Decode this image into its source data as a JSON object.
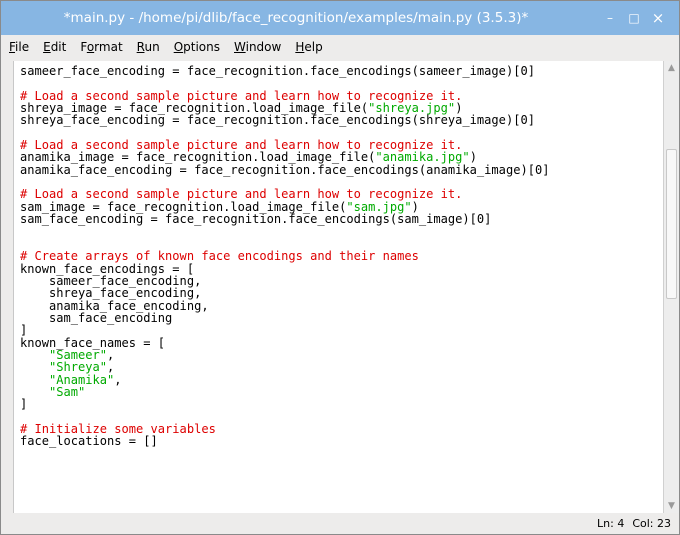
{
  "window": {
    "title": "*main.py - /home/pi/dlib/face_recognition/examples/main.py (3.5.3)*",
    "minimize_glyph": "–",
    "maximize_glyph": "□",
    "close_glyph": "×"
  },
  "menu": [
    {
      "mnemonic": "F",
      "rest": "ile"
    },
    {
      "mnemonic": "E",
      "rest": "dit"
    },
    {
      "pre": "F",
      "mnemonic": "o",
      "rest": "rmat"
    },
    {
      "mnemonic": "R",
      "rest": "un"
    },
    {
      "mnemonic": "O",
      "rest": "ptions"
    },
    {
      "mnemonic": "W",
      "rest": "indow"
    },
    {
      "mnemonic": "H",
      "rest": "elp"
    }
  ],
  "code_lines": [
    [
      {
        "t": "sameer_face_encoding = face_recognition.face_encodings(sameer_image)[0]"
      }
    ],
    [],
    [
      {
        "t": "# Load a second sample picture and learn how to recognize it.",
        "c": "cm"
      }
    ],
    [
      {
        "t": "shreya_image = face_recognition.load_image_file("
      },
      {
        "t": "\"shreya.jpg\"",
        "c": "st"
      },
      {
        "t": ")"
      }
    ],
    [
      {
        "t": "shreya_face_encoding = face_recognition.face_encodings(shreya_image)[0]"
      }
    ],
    [],
    [
      {
        "t": "# Load a second sample picture and learn how to recognize it.",
        "c": "cm"
      }
    ],
    [
      {
        "t": "anamika_image = face_recognition.load_image_file("
      },
      {
        "t": "\"anamika.jpg\"",
        "c": "st"
      },
      {
        "t": ")"
      }
    ],
    [
      {
        "t": "anamika_face_encoding = face_recognition.face_encodings(anamika_image)[0]"
      }
    ],
    [],
    [
      {
        "t": "# Load a second sample picture and learn how to recognize it.",
        "c": "cm"
      }
    ],
    [
      {
        "t": "sam_image = face_recognition.load_image_file("
      },
      {
        "t": "\"sam.jpg\"",
        "c": "st"
      },
      {
        "t": ")"
      }
    ],
    [
      {
        "t": "sam_face_encoding = face_recognition.face_encodings(sam_image)[0]"
      }
    ],
    [],
    [],
    [
      {
        "t": "# Create arrays of known face encodings and their names",
        "c": "cm"
      }
    ],
    [
      {
        "t": "known_face_encodings = ["
      }
    ],
    [
      {
        "t": "    sameer_face_encoding,"
      }
    ],
    [
      {
        "t": "    shreya_face_encoding,"
      }
    ],
    [
      {
        "t": "    anamika_face_encoding,"
      }
    ],
    [
      {
        "t": "    sam_face_encoding"
      }
    ],
    [
      {
        "t": "]"
      }
    ],
    [
      {
        "t": "known_face_names = ["
      }
    ],
    [
      {
        "t": "    "
      },
      {
        "t": "\"Sameer\"",
        "c": "st"
      },
      {
        "t": ","
      }
    ],
    [
      {
        "t": "    "
      },
      {
        "t": "\"Shreya\"",
        "c": "st"
      },
      {
        "t": ","
      }
    ],
    [
      {
        "t": "    "
      },
      {
        "t": "\"Anamika\"",
        "c": "st"
      },
      {
        "t": ","
      }
    ],
    [
      {
        "t": "    "
      },
      {
        "t": "\"Sam\"",
        "c": "st"
      }
    ],
    [
      {
        "t": "]"
      }
    ],
    [],
    [
      {
        "t": "# Initialize some variables",
        "c": "cm"
      }
    ],
    [
      {
        "t": "face_locations = []"
      }
    ]
  ],
  "colors": {
    "titlebar": "#87b6e3",
    "comment": "#dd0000",
    "string": "#00aa00"
  },
  "status": {
    "line": "Ln: 4",
    "col": "Col: 23"
  }
}
